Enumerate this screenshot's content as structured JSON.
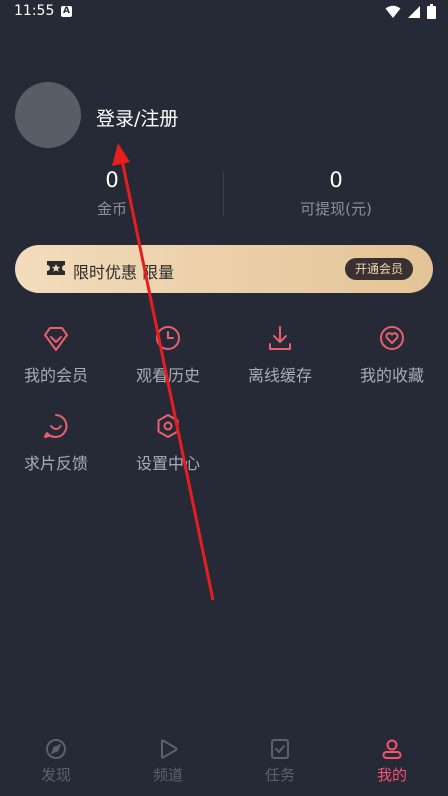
{
  "status_bar": {
    "time": "11:55",
    "badge": "A"
  },
  "profile": {
    "login_label": "登录/注册"
  },
  "stats": [
    {
      "value": "0",
      "label": "金币"
    },
    {
      "value": "0",
      "label": "可提现(元)"
    }
  ],
  "vip_banner": {
    "text": "限时优惠 限量",
    "button": "开通会员"
  },
  "menu": [
    {
      "label": "我的会员",
      "icon": "diamond-icon"
    },
    {
      "label": "观看历史",
      "icon": "clock-icon"
    },
    {
      "label": "离线缓存",
      "icon": "download-icon"
    },
    {
      "label": "我的收藏",
      "icon": "heart-icon"
    },
    {
      "label": "求片反馈",
      "icon": "chat-smile-icon"
    },
    {
      "label": "设置中心",
      "icon": "settings-hex-icon"
    }
  ],
  "tabs": [
    {
      "label": "发现",
      "icon": "compass-icon",
      "active": false
    },
    {
      "label": "频道",
      "icon": "play-icon",
      "active": false
    },
    {
      "label": "任务",
      "icon": "task-icon",
      "active": false
    },
    {
      "label": "我的",
      "icon": "user-icon",
      "active": true
    }
  ],
  "colors": {
    "background": "#262a37",
    "accent": "#f4536d",
    "icon_red": "#e9606f",
    "muted_text": "#a9acb5"
  }
}
